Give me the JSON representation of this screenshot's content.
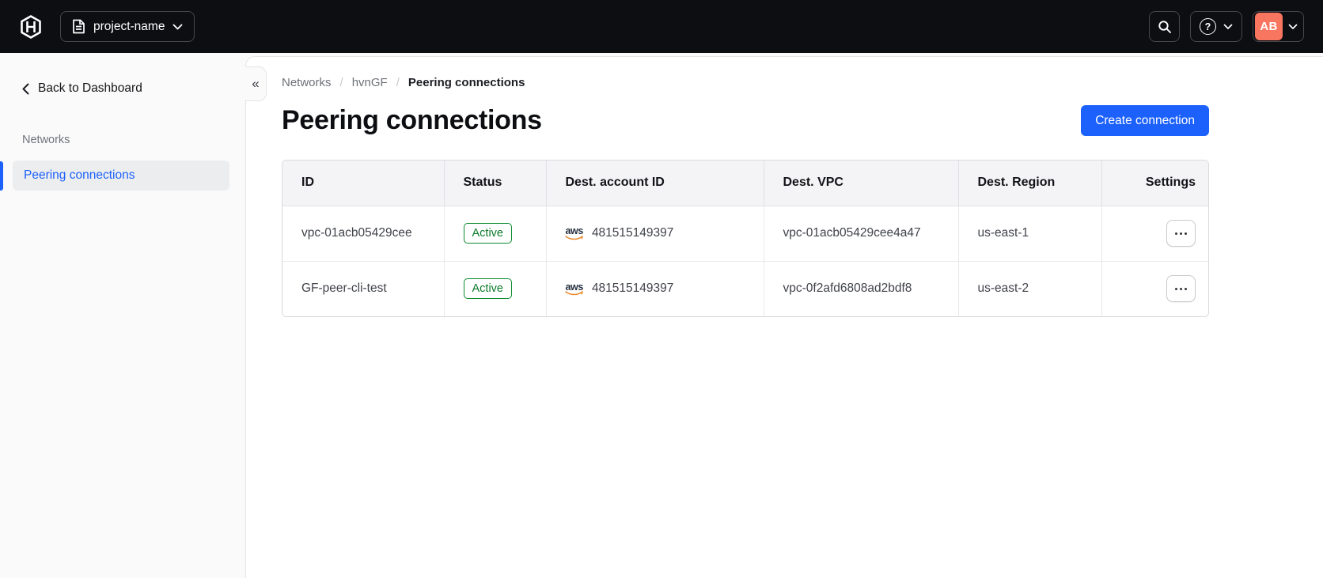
{
  "colors": {
    "header_bg": "#0d0e12",
    "accent_blue": "#1c61fb",
    "success_green_border": "#0c8a2e",
    "success_green_text": "#0b7a29",
    "avatar_bg": "#f8765f",
    "aws_orange": "#e8882c"
  },
  "topbar": {
    "project_switcher_label": "project-name",
    "help_glyph": "?",
    "account_initials": "AB"
  },
  "sidebar": {
    "back_label": "Back to Dashboard",
    "section_label": "Networks",
    "items": [
      {
        "label": "Peering connections",
        "active": true
      }
    ],
    "collapse_glyph": "«"
  },
  "breadcrumb": {
    "items": [
      "Networks",
      "hvnGF",
      "Peering connections"
    ],
    "separator": "/"
  },
  "page": {
    "title": "Peering connections",
    "create_button_label": "Create connection"
  },
  "table": {
    "columns": [
      "ID",
      "Status",
      "Dest. account ID",
      "Dest. VPC",
      "Dest. Region",
      "Settings"
    ],
    "provider_label": "aws",
    "rows": [
      {
        "id": "vpc-01acb05429cee",
        "status": "Active",
        "dest_account_id": "481515149397",
        "dest_vpc": "vpc-01acb05429cee4a47",
        "dest_region": "us-east-1"
      },
      {
        "id": "GF-peer-cli-test",
        "status": "Active",
        "dest_account_id": "481515149397",
        "dest_vpc": "vpc-0f2afd6808ad2bdf8",
        "dest_region": "us-east-2"
      }
    ]
  }
}
